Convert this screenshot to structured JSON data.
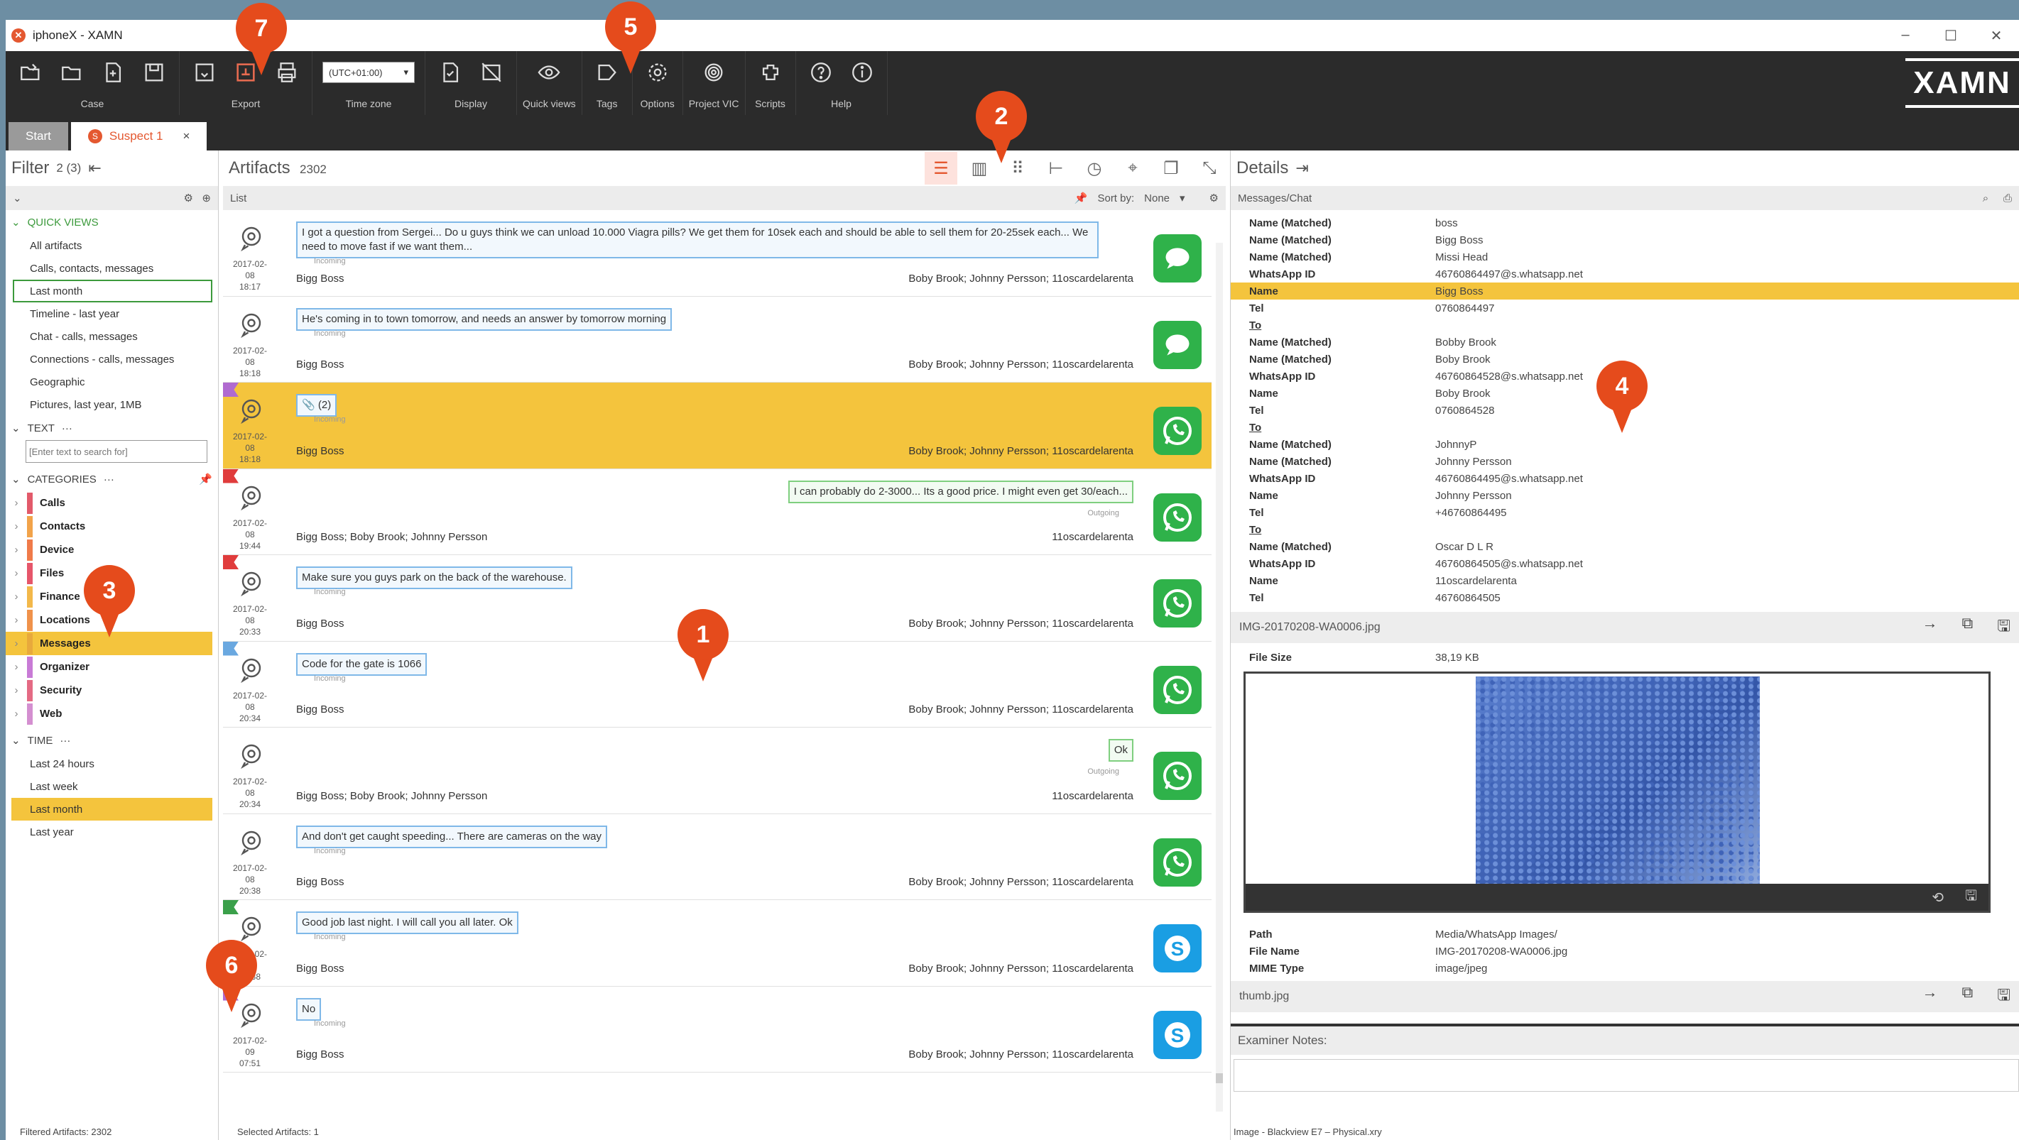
{
  "window": {
    "title": "iphoneX - XAMN",
    "logo": "XAMN",
    "min": "–",
    "max": "☐",
    "close": "✕"
  },
  "ribbon": {
    "groups": [
      {
        "label": "Case"
      },
      {
        "label": "Export"
      },
      {
        "label": "Time zone",
        "timezone": "(UTC+01:00)"
      },
      {
        "label": "Display"
      },
      {
        "label": "Quick views"
      },
      {
        "label": "Tags"
      },
      {
        "label": "Options"
      },
      {
        "label": "Project VIC"
      },
      {
        "label": "Scripts"
      },
      {
        "label": "Help"
      }
    ]
  },
  "tabs": {
    "start": "Start",
    "suspect": "Suspect 1",
    "suspect_badge": "S",
    "close": "×"
  },
  "filter": {
    "title": "Filter",
    "count": "2 (3)",
    "quick_views_header": "QUICK VIEWS",
    "quick_views": [
      "All artifacts",
      "Calls, contacts, messages",
      "Last month",
      "Timeline - last year",
      "Chat - calls, messages",
      "Connections - calls, messages",
      "Geographic",
      "Pictures, last year, 1MB"
    ],
    "text_header": "TEXT",
    "text_placeholder": "[Enter text to search for]",
    "categories_header": "CATEGORIES",
    "categories": [
      {
        "label": "Calls",
        "color": "#e25a6a"
      },
      {
        "label": "Contacts",
        "color": "#f2a34a"
      },
      {
        "label": "Device",
        "color": "#f07b4a"
      },
      {
        "label": "Files",
        "color": "#e6566a"
      },
      {
        "label": "Finance",
        "color": "#f3b84a"
      },
      {
        "label": "Locations",
        "color": "#f0924b"
      },
      {
        "label": "Messages",
        "color": "#e8a93c"
      },
      {
        "label": "Organizer",
        "color": "#c87bd6"
      },
      {
        "label": "Security",
        "color": "#e46a84"
      },
      {
        "label": "Web",
        "color": "#d48fd0"
      }
    ],
    "time_header": "TIME",
    "time": [
      "Last 24 hours",
      "Last week",
      "Last month",
      "Last year"
    ],
    "status": "Filtered Artifacts: 2302"
  },
  "artifacts": {
    "title": "Artifacts",
    "count": "2302",
    "list_label": "List",
    "sort_label": "Sort by:",
    "sort_value": "None",
    "status": "Selected Artifacts: 1",
    "rows": [
      {
        "date": "2017-02-08",
        "time": "18:17",
        "text": "I got a question from Sergei... Do u guys think we can unload 10.000 Viagra pills? We get them for 10sek each and should be able to sell them for 20-25sek each... We need to move fast if we want them...",
        "dir": "Incoming",
        "from": "Bigg Boss",
        "to": "Boby Brook; Johnny Persson; 11oscardelarenta",
        "app": "sms"
      },
      {
        "date": "2017-02-08",
        "time": "18:18",
        "text": "He's coming in to town tomorrow, and needs an answer by tomorrow morning",
        "dir": "Incoming",
        "from": "Bigg Boss",
        "to": "Boby Brook; Johnny Persson; 11oscardelarenta",
        "app": "sms"
      },
      {
        "date": "2017-02-08",
        "time": "18:18",
        "text": "(2)",
        "dir": "Incoming",
        "from": "Bigg Boss",
        "to": "Boby Brook; Johnny Persson; 11oscardelarenta",
        "app": "wa",
        "flag": "#b06ad0"
      },
      {
        "date": "2017-02-08",
        "time": "19:44",
        "text": "I can probably do 2-3000... Its a good price. I might even get 30/each...",
        "dir": "Outgoing",
        "from": "Bigg Boss; Boby Brook; Johnny Persson",
        "to": "11oscardelarenta",
        "app": "wa",
        "flag": "#e03c3c"
      },
      {
        "date": "2017-02-08",
        "time": "20:33",
        "text": "Make sure you guys park on the back of the warehouse.",
        "dir": "Incoming",
        "from": "Bigg Boss",
        "to": "Boby Brook; Johnny Persson; 11oscardelarenta",
        "app": "wa",
        "flag": "#e03c3c"
      },
      {
        "date": "2017-02-08",
        "time": "20:34",
        "text": "Code for the gate is 1066",
        "dir": "Incoming",
        "from": "Bigg Boss",
        "to": "Boby Brook; Johnny Persson; 11oscardelarenta",
        "app": "wa",
        "flag": "#6aa8e0"
      },
      {
        "date": "2017-02-08",
        "time": "20:34",
        "text": "Ok",
        "dir": "Outgoing",
        "from": "Bigg Boss; Boby Brook; Johnny Persson",
        "to": "11oscardelarenta",
        "app": "wa"
      },
      {
        "date": "2017-02-08",
        "time": "20:38",
        "text": "And don't get caught speeding... There are cameras on the way",
        "dir": "Incoming",
        "from": "Bigg Boss",
        "to": "Boby Brook; Johnny Persson; 11oscardelarenta",
        "app": "wa"
      },
      {
        "date": "2017-02-09",
        "time": "07:38",
        "text": "Good job last night. I will call you all later. Ok",
        "dir": "Incoming",
        "from": "Bigg Boss",
        "to": "Boby Brook; Johnny Persson; 11oscardelarenta",
        "app": "sk",
        "flag": "#3aa04a"
      },
      {
        "date": "2017-02-09",
        "time": "07:51",
        "text": "No",
        "dir": "Incoming",
        "from": "Bigg Boss",
        "to": "Boby Brook; Johnny Persson; 11oscardelarenta",
        "app": "sk",
        "flag": "#b06ad0"
      }
    ]
  },
  "details": {
    "title": "Details",
    "section": "Messages/Chat",
    "rows": [
      {
        "k": "Name (Matched)",
        "v": "boss"
      },
      {
        "k": "Name (Matched)",
        "v": "Bigg Boss"
      },
      {
        "k": "Name (Matched)",
        "v": "Missi Head"
      },
      {
        "k": "WhatsApp ID",
        "v": "46760864497@s.whatsapp.net"
      },
      {
        "k": "Name",
        "v": "Bigg Boss",
        "hl": true
      },
      {
        "k": "Tel",
        "v": "0760864497"
      },
      {
        "k": "To",
        "v": "",
        "u": true
      },
      {
        "k": "Name (Matched)",
        "v": "Bobby Brook"
      },
      {
        "k": "Name (Matched)",
        "v": "Boby Brook"
      },
      {
        "k": "WhatsApp ID",
        "v": "46760864528@s.whatsapp.net"
      },
      {
        "k": "Name",
        "v": "Boby Brook"
      },
      {
        "k": "Tel",
        "v": "0760864528"
      },
      {
        "k": "To",
        "v": "",
        "u": true
      },
      {
        "k": "Name (Matched)",
        "v": "JohnnyP"
      },
      {
        "k": "Name (Matched)",
        "v": "Johnny Persson"
      },
      {
        "k": "WhatsApp ID",
        "v": "46760864495@s.whatsapp.net"
      },
      {
        "k": "Name",
        "v": "Johnny Persson"
      },
      {
        "k": "Tel",
        "v": "+46760864495"
      },
      {
        "k": "To",
        "v": "",
        "u": true
      },
      {
        "k": "Name (Matched)",
        "v": "Oscar D L R"
      },
      {
        "k": "WhatsApp ID",
        "v": "46760864505@s.whatsapp.net"
      },
      {
        "k": "Name",
        "v": "11oscardelarenta"
      },
      {
        "k": "Tel",
        "v": "46760864505"
      }
    ],
    "file1": "IMG-20170208-WA0006.jpg",
    "file_size_k": "File Size",
    "file_size_v": "38,19 KB",
    "path_k": "Path",
    "path_v": "Media/WhatsApp Images/",
    "fname_k": "File Name",
    "fname_v": "IMG-20170208-WA0006.jpg",
    "mime_k": "MIME Type",
    "mime_v": "image/jpeg",
    "file2": "thumb.jpg",
    "notes_label": "Examiner Notes:",
    "status": "Image - Blackview E7 – Physical.xry"
  },
  "callouts": [
    "1",
    "2",
    "3",
    "4",
    "5",
    "6",
    "7"
  ]
}
